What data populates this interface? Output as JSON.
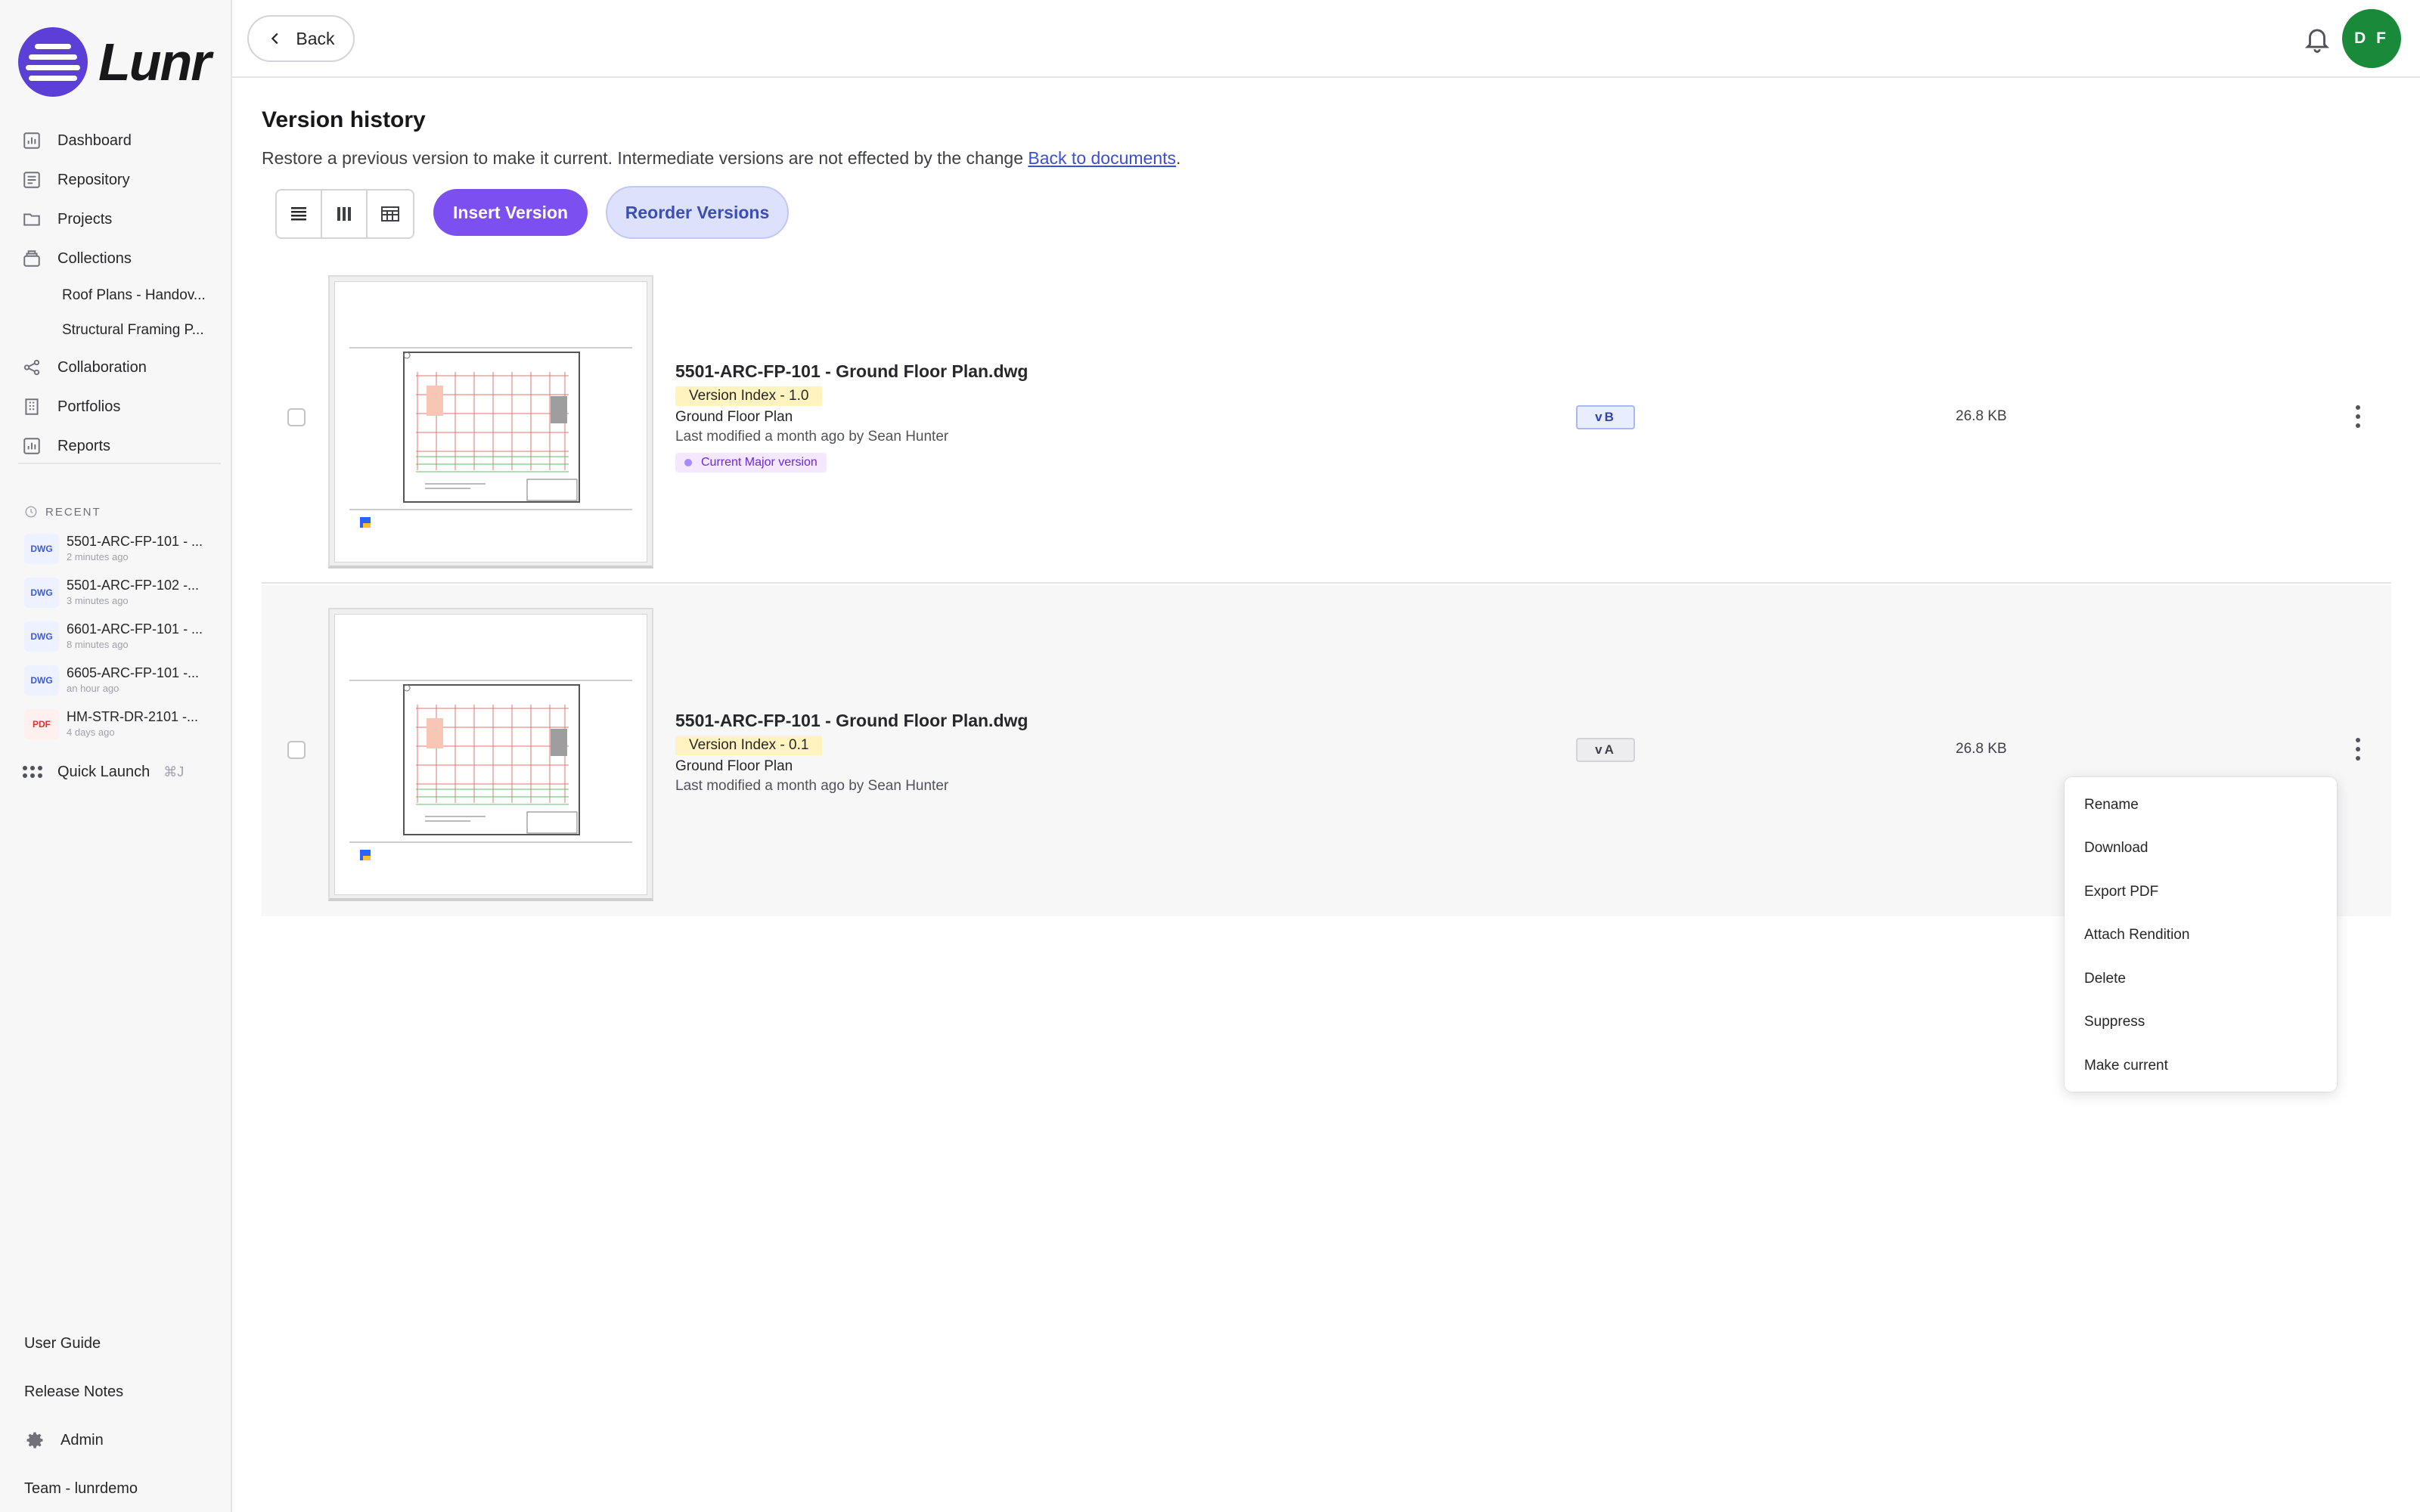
{
  "app": {
    "name": "Lunr"
  },
  "sidebar": {
    "nav": [
      {
        "label": "Dashboard",
        "icon": "chart-icon"
      },
      {
        "label": "Repository",
        "icon": "repository-icon"
      },
      {
        "label": "Projects",
        "icon": "folder-icon"
      },
      {
        "label": "Collections",
        "icon": "collections-icon"
      }
    ],
    "collections": [
      {
        "label": "Roof Plans - Handov..."
      },
      {
        "label": "Structural Framing P..."
      }
    ],
    "nav2": [
      {
        "label": "Collaboration",
        "icon": "share-icon"
      },
      {
        "label": "Portfolios",
        "icon": "building-icon"
      },
      {
        "label": "Reports",
        "icon": "chart-icon"
      }
    ],
    "recent_label": "RECENT",
    "recent": [
      {
        "type": "DWG",
        "name": "5501-ARC-FP-101 - ...",
        "time": "2 minutes ago"
      },
      {
        "type": "DWG",
        "name": "5501-ARC-FP-102 -...",
        "time": "3 minutes ago"
      },
      {
        "type": "DWG",
        "name": "6601-ARC-FP-101 - ...",
        "time": "8 minutes ago"
      },
      {
        "type": "DWG",
        "name": "6605-ARC-FP-101 -...",
        "time": "an hour ago"
      },
      {
        "type": "PDF",
        "name": "HM-STR-DR-2101 -...",
        "time": "4 days ago"
      }
    ],
    "quick_launch": {
      "label": "Quick Launch",
      "shortcut": "⌘J"
    },
    "bottom": {
      "user_guide": "User Guide",
      "release_notes": "Release Notes",
      "admin": "Admin",
      "team": "Team - lunrdemo"
    }
  },
  "header": {
    "back_label": "Back",
    "avatar_initials": "D F"
  },
  "main": {
    "title": "Version history",
    "subtitle": "Restore a previous version to make it current. Intermediate versions are not effected by the change",
    "subtitle_link": "Back to documents",
    "subtitle_end": ".",
    "insert_label": "Insert Version",
    "reorder_label": "Reorder Versions",
    "versions": [
      {
        "name": "5501-ARC-FP-101 - Ground Floor Plan.dwg",
        "version_index": "Version Index - 1.0",
        "description": "Ground Floor Plan",
        "modified": "Last modified a month ago by Sean Hunter",
        "major_label": "Current Major version",
        "badge": "vB",
        "size": "26.8 KB"
      },
      {
        "name": "5501-ARC-FP-101 - Ground Floor Plan.dwg",
        "version_index": "Version Index - 0.1",
        "description": "Ground Floor Plan",
        "modified": "Last modified a month ago by Sean Hunter",
        "badge": "vA",
        "size": "26.8 KB"
      }
    ]
  },
  "context_menu": {
    "items": [
      "Rename",
      "Download",
      "Export PDF",
      "Attach Rendition",
      "Delete",
      "Suppress",
      "Make current"
    ]
  },
  "colors": {
    "primary": "#7c4ff0",
    "secondary": "#dde1fb",
    "avatar": "#198a3a",
    "brand": "#5b3fd6",
    "version_tag": "#fff3bf"
  }
}
